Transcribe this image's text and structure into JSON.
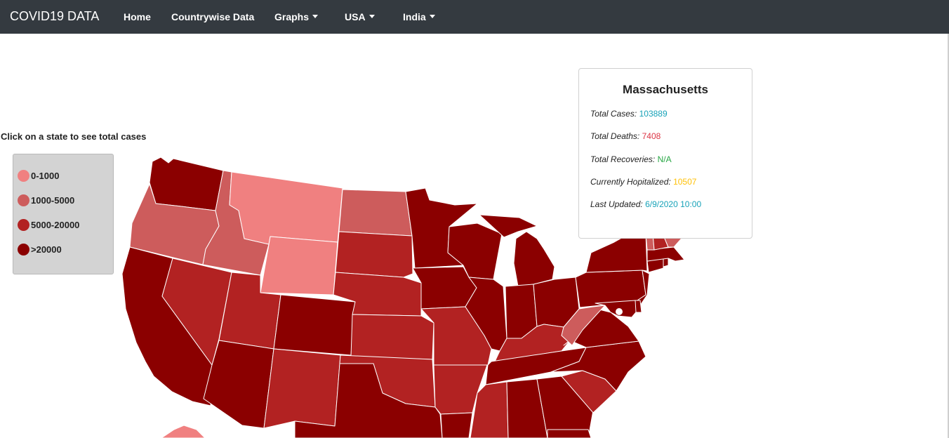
{
  "nav": {
    "brand": "COVID19 DATA",
    "items": [
      {
        "label": "Home"
      },
      {
        "label": "Countrywise Data"
      },
      {
        "label": "Graphs"
      },
      {
        "label": "USA"
      },
      {
        "label": "India"
      }
    ]
  },
  "map": {
    "instruction": "Click on a state to see total cases",
    "legend": [
      {
        "label": "0-1000",
        "color": "#f08080"
      },
      {
        "label": "1000-5000",
        "color": "#cd5c5c"
      },
      {
        "label": "5000-20000",
        "color": "#b22222"
      },
      {
        "label": ">20000",
        "color": "#8b0000"
      }
    ]
  },
  "state_info": {
    "name": "Massachusetts",
    "cases_label": "Total Cases:",
    "cases": "103889",
    "deaths_label": "Total Deaths:",
    "deaths": "7408",
    "recoveries_label": "Total Recoveries:",
    "recoveries": "N/A",
    "hospitalized_label": "Currently Hopitalized:",
    "hospitalized": "10507",
    "updated_label": "Last Updated:",
    "updated": "6/9/2020 10:00"
  },
  "colors": {
    "navbar": "#343a40",
    "cases_value": "#17a2b8",
    "deaths_value": "#dc3545",
    "recoveries_value": "#28a745",
    "hospitalized_value": "#ffc107",
    "updated_value": "#17a2b8"
  }
}
